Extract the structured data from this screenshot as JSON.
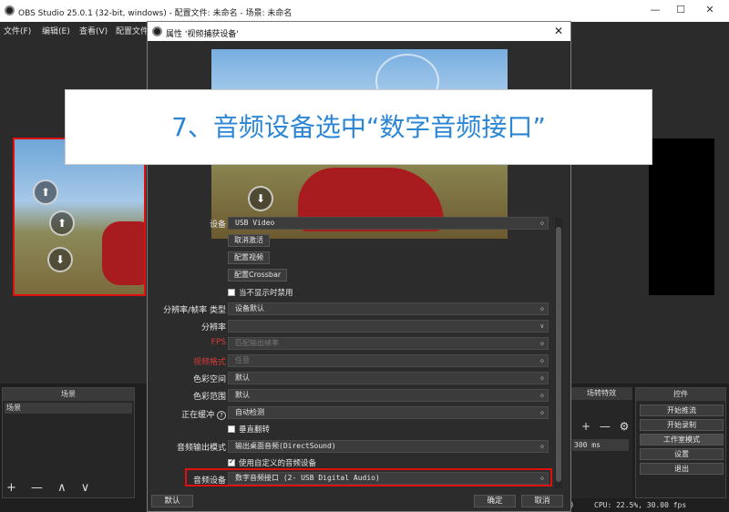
{
  "window": {
    "title": "OBS Studio 25.0.1 (32-bit, windows) - 配置文件: 未命名 - 场景: 未命名",
    "minimize": "—",
    "maximize": "☐",
    "close": "✕"
  },
  "menu": [
    "文件(F)",
    "编辑(E)",
    "查看(V)",
    "配置文件"
  ],
  "dialog": {
    "title": "属性 '视频捕获设备'",
    "close": "✕",
    "rows": {
      "device_label": "设备",
      "device_value": "USB Video",
      "deactivate_btn": "取消激活",
      "config_video_btn": "配置视频",
      "config_crossbar_btn": "配置Crossbar",
      "deactivate_when_hidden": "当不显示时禁用",
      "res_type_label": "分辨率/帧率 类型",
      "res_type_value": "设备默认",
      "resolution_label": "分辨率",
      "resolution_value": "",
      "fps_label": "FPS",
      "fps_value": "匹配输出帧率",
      "video_format_label": "视频格式",
      "video_format_value": "任意",
      "color_space_label": "色彩空间",
      "color_space_value": "默认",
      "color_range_label": "色彩范围",
      "color_range_value": "默认",
      "buffering_label": "正在缓冲",
      "buffering_help": "?",
      "buffering_value": "自动检测",
      "flip_vertical": "垂直翻转",
      "audio_output_label": "音频输出模式",
      "audio_output_value": "输出桌面音频(DirectSound)",
      "custom_audio": "使用自定义的音频设备",
      "audio_device_label": "音频设备",
      "audio_device_value": "数字音频接口 (2- USB Digital Audio)"
    },
    "footer": {
      "defaults": "默认",
      "ok": "确定",
      "cancel": "取消"
    }
  },
  "banner": "7、音频设备选中“数字音频接口”",
  "docks": {
    "scenes_title": "场景",
    "scene_item": "场景",
    "scene_tools": "+ — ∧ ∨",
    "controls_title": "控件",
    "controls": [
      "开始推流",
      "开始录制",
      "工作室模式",
      "设置",
      "退出"
    ],
    "transitions_title": "场转特效",
    "duration": "300 ms",
    "trans_tools": "+ — ⚙"
  },
  "status": {
    "text": "CPU: 22.5%, 30.00 fps",
    "left_digit": "0"
  },
  "game": {
    "labels": [
      "匹",
      "配"
    ]
  },
  "colors": {
    "banner_text": "#2b86d6",
    "highlight": "#e01010"
  }
}
